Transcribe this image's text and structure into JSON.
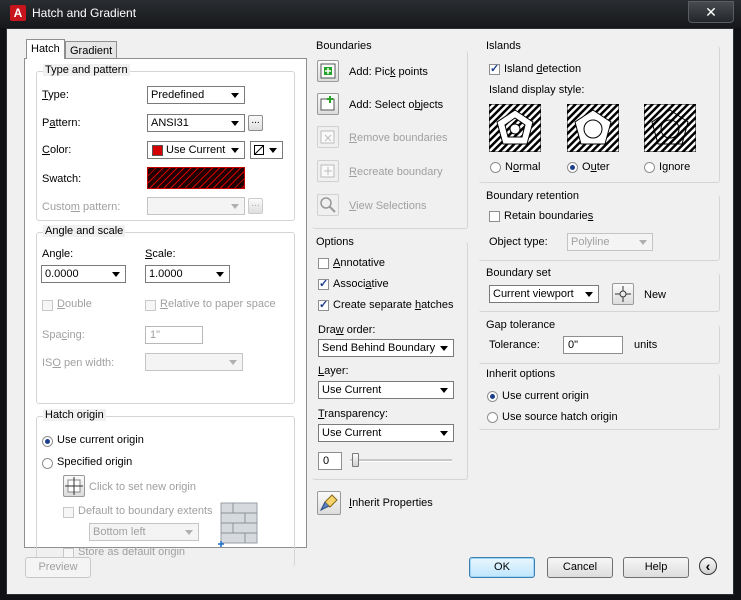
{
  "window": {
    "title": "Hatch and Gradient",
    "app_logo": "A",
    "close_glyph": "✕"
  },
  "tabs": [
    {
      "label": "Hatch"
    },
    {
      "label": "Gradient"
    }
  ],
  "type_pattern": {
    "title": "Type and pattern",
    "type_label": "Type:",
    "type_value": "Predefined",
    "pattern_label": "Pattern:",
    "pattern_value": "ANSI31",
    "color_label": "Color:",
    "color_value": "Use Current",
    "color_swatch": "#d40000",
    "swatch_label": "Swatch:",
    "custom_label": "Custom pattern:",
    "custom_value": "",
    "ellipsis": "..."
  },
  "angle_scale": {
    "title": "Angle and scale",
    "angle_label": "Angle:",
    "angle_value": "0.0000",
    "scale_label": "Scale:",
    "scale_value": "1.0000",
    "double_label": "Double",
    "relative_label": "Relative to paper space",
    "spacing_label": "Spacing:",
    "spacing_value": "1\"",
    "iso_label": "ISO pen width:"
  },
  "hatch_origin": {
    "title": "Hatch origin",
    "use_current_label": "Use current origin",
    "specified_label": "Specified origin",
    "click_label": "Click to set new origin",
    "default_extents_label": "Default to boundary extents",
    "position_value": "Bottom left",
    "store_label": "Store as default origin"
  },
  "boundaries": {
    "title": "Boundaries",
    "add_pick": "Add: Pick points",
    "add_select": "Add: Select objects",
    "remove": "Remove boundaries",
    "recreate": "Recreate boundary",
    "view": "View Selections"
  },
  "options": {
    "title": "Options",
    "annotative": "Annotative",
    "associative": "Associative",
    "separate": "Create separate hatches",
    "draw_order_label": "Draw order:",
    "draw_order_value": "Send Behind Boundary",
    "layer_label": "Layer:",
    "layer_value": "Use Current",
    "transparency_label": "Transparency:",
    "transparency_value": "Use Current",
    "transparency_level": "0",
    "inherit": "Inherit Properties"
  },
  "islands": {
    "title": "Islands",
    "detection_label": "Island detection",
    "style_label": "Island display style:",
    "normal": "Normal",
    "outer": "Outer",
    "ignore": "Ignore"
  },
  "boundary_retention": {
    "title": "Boundary retention",
    "retain_label": "Retain boundaries",
    "object_type_label": "Object type:",
    "object_type_value": "Polyline"
  },
  "boundary_set": {
    "title": "Boundary set",
    "value": "Current viewport",
    "new_label": "New"
  },
  "gap": {
    "title": "Gap tolerance",
    "tolerance_label": "Tolerance:",
    "tolerance_value": "0\"",
    "units": "units"
  },
  "inherit_options": {
    "title": "Inherit options",
    "use_current": "Use current origin",
    "use_source": "Use source hatch origin"
  },
  "buttons": {
    "preview": "Preview",
    "ok": "OK",
    "cancel": "Cancel",
    "help": "Help",
    "expand_glyph": "‹"
  }
}
